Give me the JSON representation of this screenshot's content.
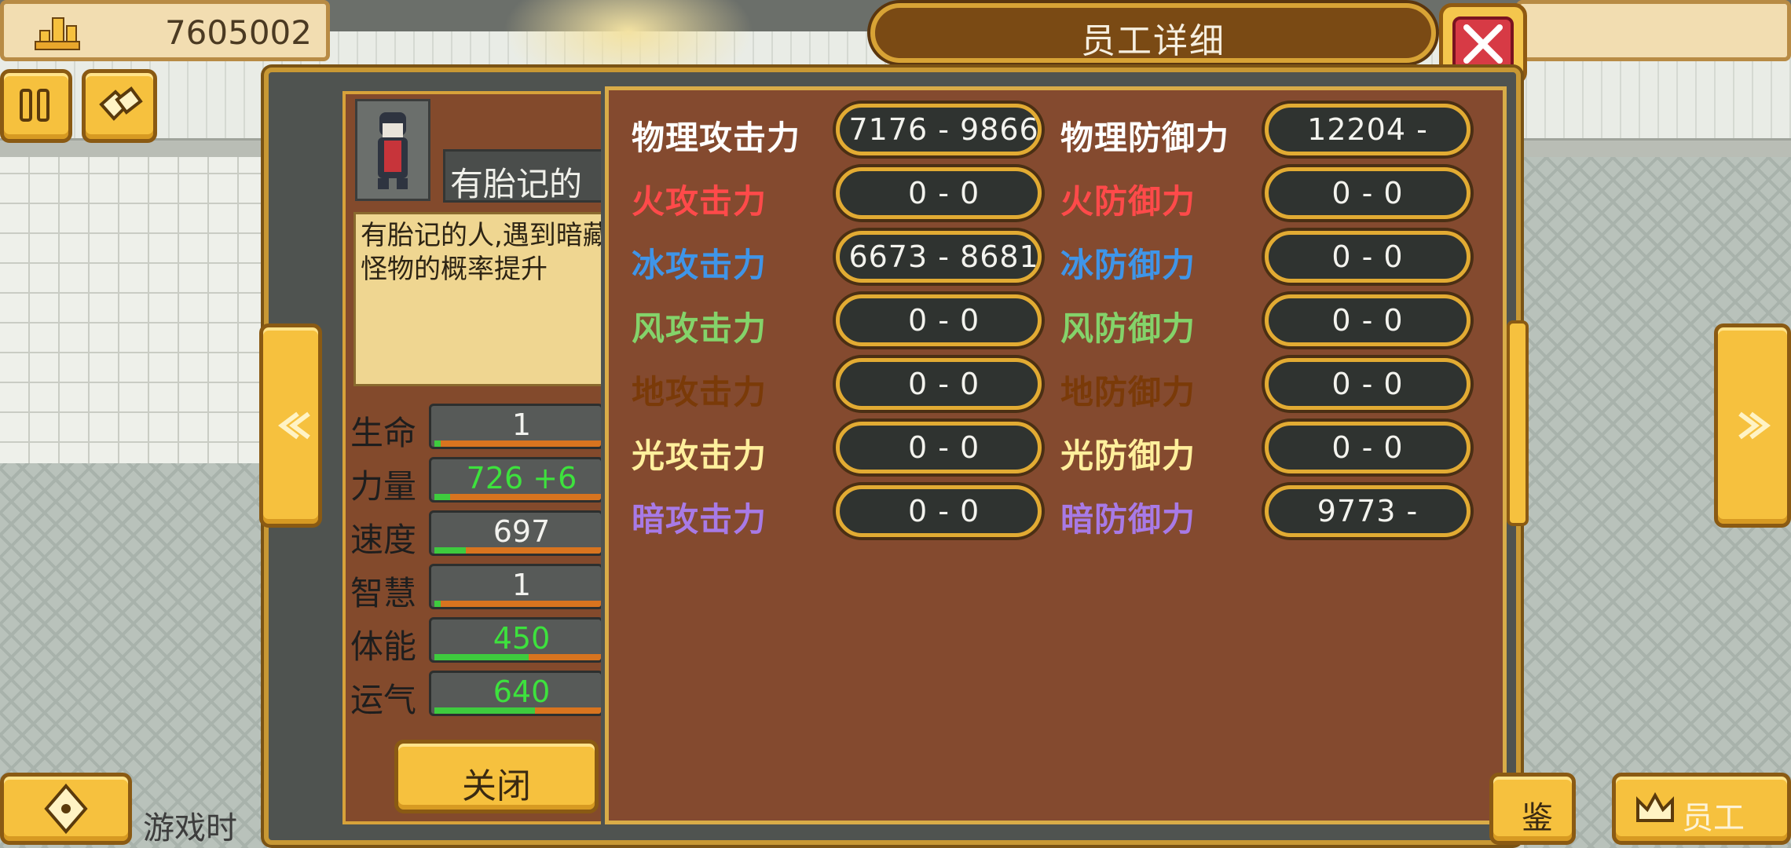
{
  "header": {
    "currency_value": "7605002",
    "window_title": "员工详细"
  },
  "employee": {
    "name": "有胎记的",
    "description": "有胎记的人,遇到暗藏大怪物的概率提升"
  },
  "stats": [
    {
      "label": "生命",
      "value": "1",
      "fill": 0.02,
      "color": "#f2f2ee"
    },
    {
      "label": "力量",
      "value": "726 +6",
      "fill": 0.05,
      "color": "#3de23d"
    },
    {
      "label": "速度",
      "value": "697",
      "fill": 0.1,
      "color": "#f2f2ee"
    },
    {
      "label": "智慧",
      "value": "1",
      "fill": 0.02,
      "color": "#f2f2ee"
    },
    {
      "label": "体能",
      "value": "450",
      "fill": 0.3,
      "color": "#3de23d"
    },
    {
      "label": "运气",
      "value": "640",
      "fill": 0.32,
      "color": "#3de23d"
    }
  ],
  "attributes": [
    {
      "attack_label": "物理攻击力",
      "attack_value": "7176 - 9866",
      "defense_label": "物理防御力",
      "defense_value": "12204 -",
      "color": "#ffffff"
    },
    {
      "attack_label": "火攻击力",
      "attack_value": "0 - 0",
      "defense_label": "火防御力",
      "defense_value": "0 - 0",
      "color": "#ff4a4a"
    },
    {
      "attack_label": "冰攻击力",
      "attack_value": "6673 - 8681",
      "defense_label": "冰防御力",
      "defense_value": "0 - 0",
      "color": "#3f95e8"
    },
    {
      "attack_label": "风攻击力",
      "attack_value": "0 - 0",
      "defense_label": "风防御力",
      "defense_value": "0 - 0",
      "color": "#84d36a"
    },
    {
      "attack_label": "地攻击力",
      "attack_value": "0 - 0",
      "defense_label": "地防御力",
      "defense_value": "0 - 0",
      "color": "#7a3a08"
    },
    {
      "attack_label": "光攻击力",
      "attack_value": "0 - 0",
      "defense_label": "光防御力",
      "defense_value": "0 - 0",
      "color": "#ffef9c"
    },
    {
      "attack_label": "暗攻击力",
      "attack_value": "0 - 0",
      "defense_label": "暗防御力",
      "defense_value": "9773 -",
      "color": "#a87ae6"
    }
  ],
  "buttons": {
    "close_label": "关闭",
    "dictionary_label": "鉴",
    "staff_label": "员工"
  },
  "footer": {
    "game_time_label": "游戏时"
  },
  "icons": {
    "currency": "building-coins-icon",
    "pause": "pause-icon",
    "map": "map-icon",
    "close": "close-icon",
    "prev": "double-chevron-left-icon",
    "next": "double-chevron-right-icon",
    "move": "dpad-icon",
    "staff": "crown-icon"
  }
}
